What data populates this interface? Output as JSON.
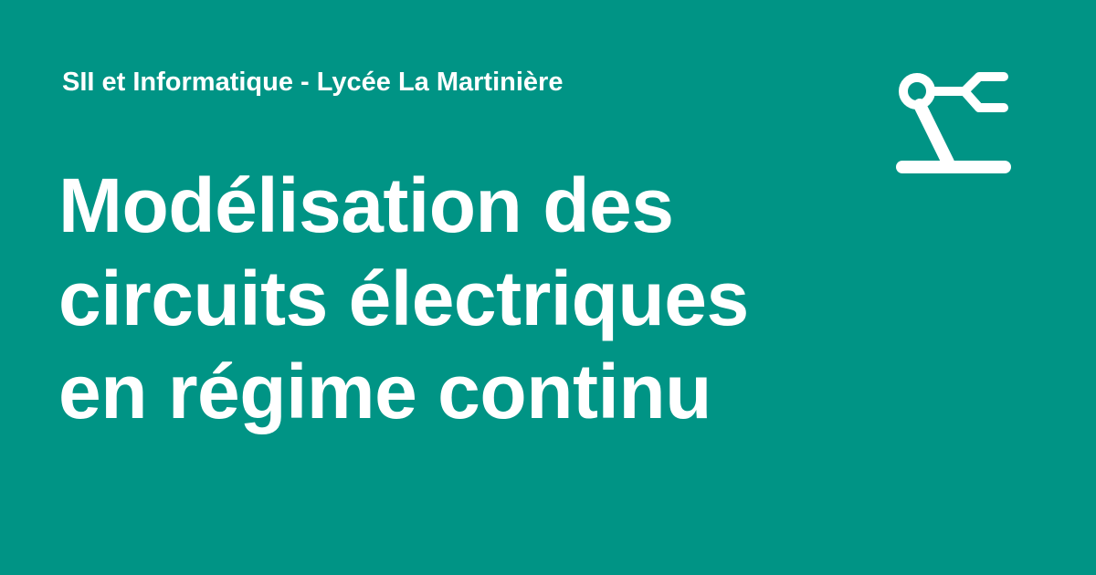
{
  "site": {
    "name": "SII et Informatique - Lycée La Martinière"
  },
  "page": {
    "title_lines": [
      "Modélisation des",
      "circuits électriques",
      "en régime continu"
    ]
  },
  "logo": {
    "icon": "robot-arm-icon"
  },
  "colors": {
    "background": "#009485",
    "foreground": "#ffffff"
  }
}
